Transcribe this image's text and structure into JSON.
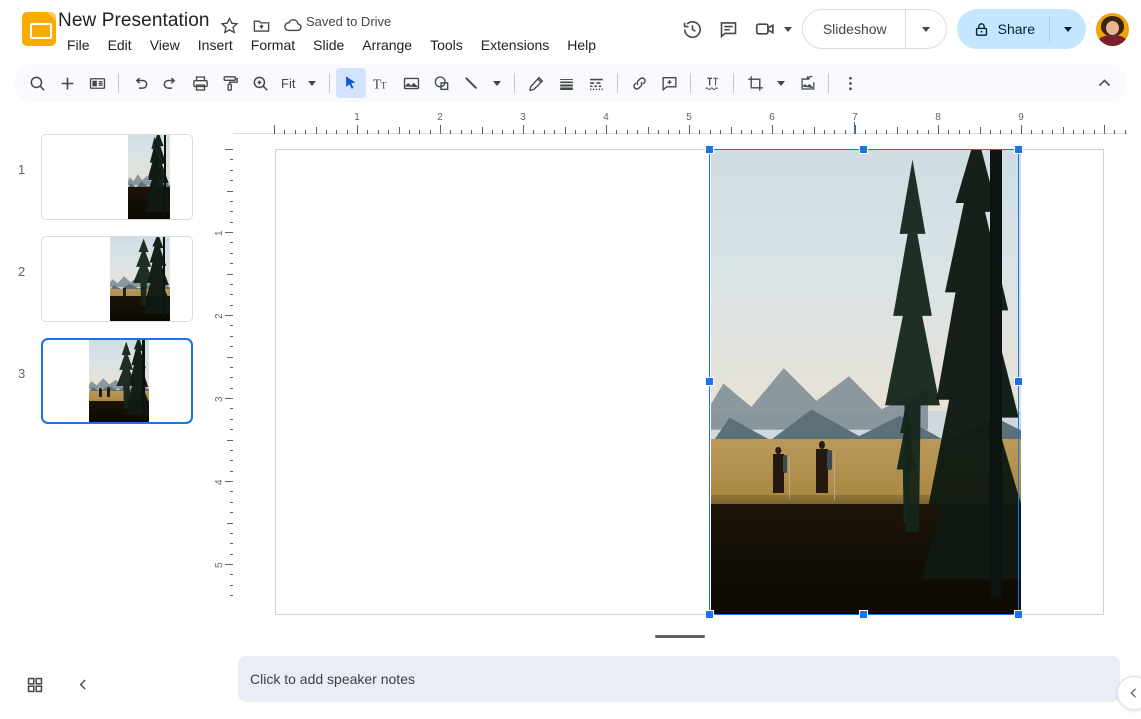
{
  "app": {
    "logo_icon": "slides-logo-icon",
    "title": "New Presentation",
    "star_icon": "star-icon",
    "move_icon": "move-to-folder-icon",
    "cloud_icon": "cloud-saved-icon",
    "save_status": "Saved to Drive"
  },
  "menus": [
    {
      "label": "File"
    },
    {
      "label": "Edit"
    },
    {
      "label": "View"
    },
    {
      "label": "Insert"
    },
    {
      "label": "Format"
    },
    {
      "label": "Slide"
    },
    {
      "label": "Arrange"
    },
    {
      "label": "Tools"
    },
    {
      "label": "Extensions"
    },
    {
      "label": "Help"
    }
  ],
  "header_actions": {
    "history_icon": "version-history-icon",
    "comment_icon": "comment-icon",
    "meet_icon": "video-camera-icon",
    "meet_caret_icon": "chevron-down-icon",
    "slideshow_label": "Slideshow",
    "slideshow_caret_icon": "chevron-down-icon",
    "share_lock_icon": "lock-icon",
    "share_label": "Share",
    "share_caret_icon": "chevron-down-icon",
    "avatar_name": "user-avatar"
  },
  "toolbar": {
    "zoom_value": "Fit",
    "items": [
      {
        "name": "search-icon"
      },
      {
        "name": "new-slide-icon"
      },
      {
        "name": "layout-icon"
      },
      {
        "name": "undo-icon"
      },
      {
        "name": "redo-icon"
      },
      {
        "name": "print-icon"
      },
      {
        "name": "paint-format-icon"
      },
      {
        "name": "zoom-icon"
      },
      {
        "name": "select-cursor-icon"
      },
      {
        "name": "text-box-icon"
      },
      {
        "name": "insert-image-icon"
      },
      {
        "name": "shape-icon"
      },
      {
        "name": "line-icon"
      },
      {
        "name": "pencil-icon"
      },
      {
        "name": "line-weight-icon"
      },
      {
        "name": "line-dash-icon"
      },
      {
        "name": "insert-link-icon"
      },
      {
        "name": "add-comment-icon"
      },
      {
        "name": "text-wrap-icon"
      },
      {
        "name": "crop-icon"
      },
      {
        "name": "mask-image-icon"
      },
      {
        "name": "more-options-icon"
      },
      {
        "name": "collapse-toolbar-icon"
      }
    ]
  },
  "rulers": {
    "horizontal_labels": [
      "1",
      "2",
      "3",
      "4",
      "5",
      "6",
      "7",
      "8",
      "9"
    ],
    "vertical_labels": [
      "1",
      "2",
      "3",
      "4",
      "5"
    ],
    "unit": "inches"
  },
  "filmstrip": {
    "slides": [
      {
        "number": "1",
        "selected": false
      },
      {
        "number": "2",
        "selected": false
      },
      {
        "number": "3",
        "selected": true
      }
    ]
  },
  "canvas": {
    "selected_object": "image-hikers-mountain",
    "selection_handles": 8
  },
  "notes": {
    "placeholder": "Click to add speaker notes",
    "resize_handle": "notes-resize-handle"
  },
  "footer": {
    "grid_icon": "grid-view-icon",
    "collapse_icon": "collapse-filmstrip-icon",
    "expand_panel_icon": "expand-side-panel-icon"
  },
  "colors": {
    "accent": "#1a73e8",
    "share_bg": "#c2e7ff",
    "logo": "#F9AB00",
    "toolbar_bg": "#f8fafd",
    "notes_bg": "#e9eef6"
  }
}
